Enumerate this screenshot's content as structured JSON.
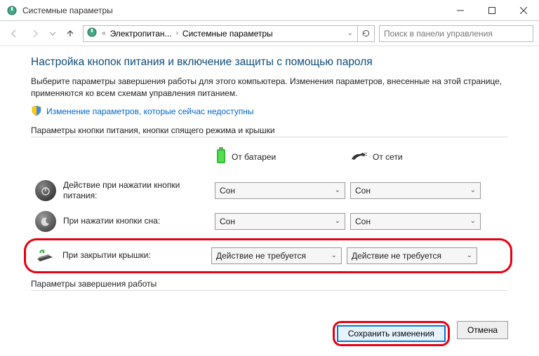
{
  "window": {
    "title": "Системные параметры"
  },
  "nav": {
    "addr_prefix": "«",
    "addr_seg1": "Электропитан...",
    "addr_seg2": "Системные параметры",
    "search_placeholder": "Поиск в панели управления"
  },
  "content": {
    "heading": "Настройка кнопок питания и включение защиты с помощью пароля",
    "desc": "Выберите параметры завершения работы для этого компьютера. Изменения параметров, внесенные на этой странице, применяются ко всем схемам управления питанием.",
    "admin_link": "Изменение параметров, которые сейчас недоступны",
    "section1_label": "Параметры кнопки питания, кнопки спящего режима и крышки",
    "col_battery": "От батареи",
    "col_ac": "От сети",
    "row_power_label": "Действие при нажатии кнопки питания:",
    "row_sleep_label": "При нажатии кнопки сна:",
    "row_lid_label": "При закрытии крышки:",
    "val_sleep": "Сон",
    "val_noaction": "Действие не требуется",
    "section2_label": "Параметры завершения работы"
  },
  "buttons": {
    "save": "Сохранить изменения",
    "cancel": "Отмена"
  }
}
